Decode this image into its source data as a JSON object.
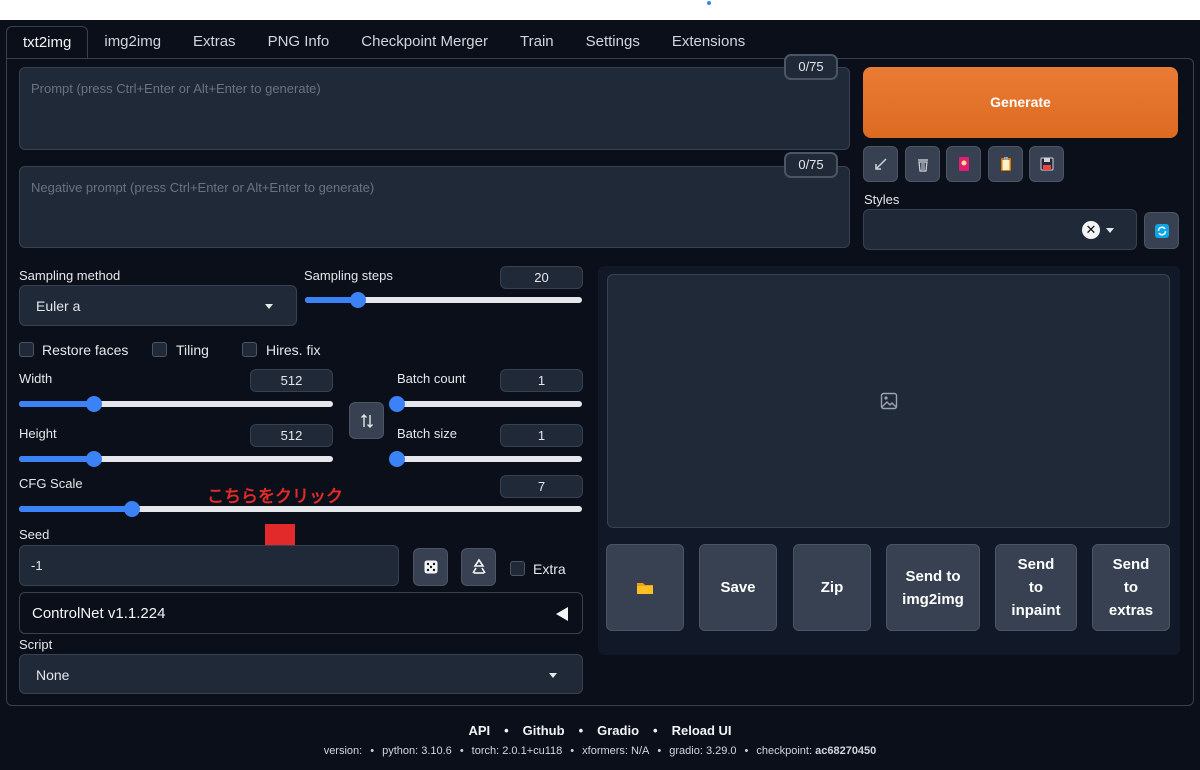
{
  "tabs": [
    "txt2img",
    "img2img",
    "Extras",
    "PNG Info",
    "Checkpoint Merger",
    "Train",
    "Settings",
    "Extensions"
  ],
  "prompt": {
    "placeholder": "Prompt (press Ctrl+Enter or Alt+Enter to generate)",
    "counter": "0/75"
  },
  "negative_prompt": {
    "placeholder": "Negative prompt (press Ctrl+Enter or Alt+Enter to generate)",
    "counter": "0/75"
  },
  "generate_label": "Generate",
  "styles_label": "Styles",
  "sampling": {
    "method_label": "Sampling method",
    "method_value": "Euler a",
    "steps_label": "Sampling steps",
    "steps_value": "20"
  },
  "checkboxes": {
    "restore_faces": "Restore faces",
    "tiling": "Tiling",
    "hires_fix": "Hires. fix",
    "extra": "Extra"
  },
  "width": {
    "label": "Width",
    "value": "512"
  },
  "height": {
    "label": "Height",
    "value": "512"
  },
  "batch_count": {
    "label": "Batch count",
    "value": "1"
  },
  "batch_size": {
    "label": "Batch size",
    "value": "1"
  },
  "cfg": {
    "label": "CFG Scale",
    "value": "7"
  },
  "seed": {
    "label": "Seed",
    "value": "-1"
  },
  "annotation": "こちらをクリック",
  "controlnet": {
    "label": "ControlNet v1.1.224"
  },
  "script": {
    "label": "Script",
    "value": "None"
  },
  "output_buttons": {
    "save": "Save",
    "zip": "Zip",
    "send_img2img_1": "Send to",
    "send_img2img_2": "img2img",
    "send_inpaint_1": "Send",
    "send_inpaint_2": "to",
    "send_inpaint_3": "inpaint",
    "send_extras_1": "Send",
    "send_extras_2": "to",
    "send_extras_3": "extras"
  },
  "footer": {
    "links": [
      "API",
      "Github",
      "Gradio",
      "Reload UI"
    ],
    "version_label": "version:",
    "python": "python: 3.10.6",
    "torch": "torch: 2.0.1+cu118",
    "xformers": "xformers: N/A",
    "gradio": "gradio: 3.29.0",
    "checkpoint_label": "checkpoint:",
    "checkpoint_value": "ac68270450"
  },
  "icons": [
    "arrow-icon",
    "trash-icon",
    "picture-card-icon",
    "clipboard-icon",
    "floppy-save-icon",
    "refresh-icon",
    "swap-icon",
    "dice-icon",
    "recycle-icon",
    "folder-icon",
    "image-placeholder-icon",
    "triangle-left-icon"
  ],
  "colors": {
    "accent_orange": "#e3712a",
    "slider_blue": "#3b82f6",
    "background": "#0b0f19",
    "annotation_red": "#e32a2a"
  },
  "slider_levels": {
    "sampling_steps": 0.19,
    "width": 0.24,
    "height": 0.24,
    "batch_count": 0.0,
    "batch_size": 0.0,
    "cfg_scale": 0.2
  }
}
